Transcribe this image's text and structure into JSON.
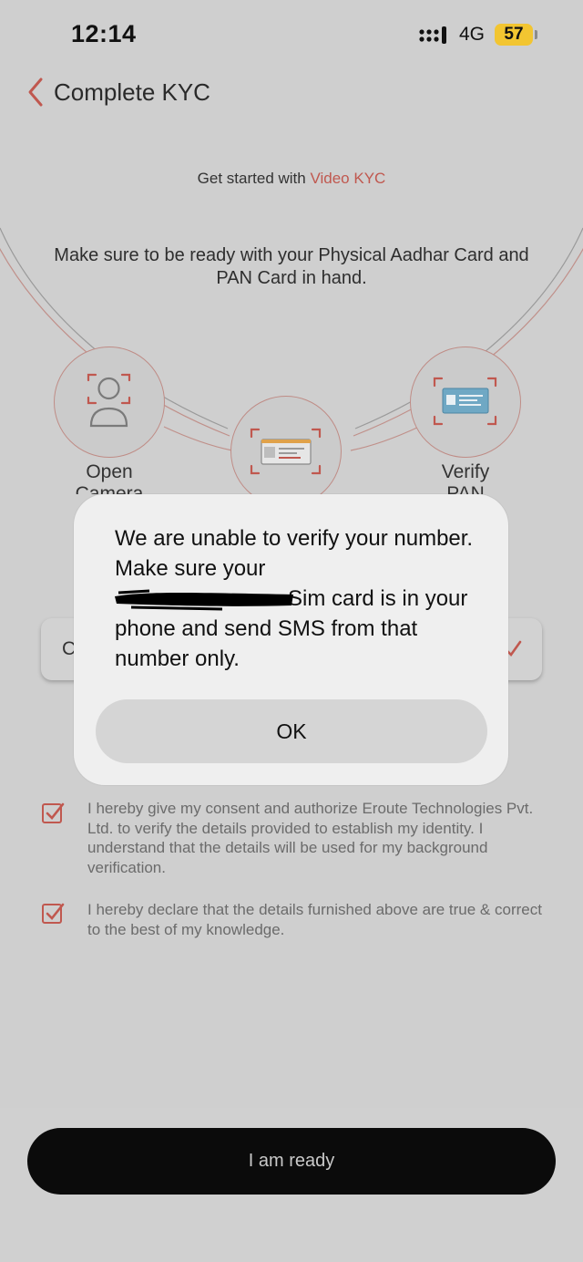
{
  "status_bar": {
    "time": "12:14",
    "network": "4G",
    "battery": "57"
  },
  "header": {
    "title": "Complete KYC"
  },
  "intro": {
    "prefix": "Get started with ",
    "highlight": "Video KYC",
    "instructions": "Make sure to be ready with your Physical Aadhar Card and PAN Card in hand."
  },
  "steps": [
    {
      "label": "Open\nCamera",
      "icon": "face-scan-icon"
    },
    {
      "label": "",
      "icon": "aadhar-card-scan-icon"
    },
    {
      "label": "Verify\nPAN",
      "icon": "pan-card-scan-icon"
    }
  ],
  "input": {
    "visible_text": "C"
  },
  "consents": [
    {
      "text": "I hereby give my consent and authorize Eroute Technologies Pvt. Ltd. to verify the details provided to establish my identity. I understand that the details will be used for my background verification.",
      "checked": true
    },
    {
      "text": "I hereby declare that the details furnished above are true & correct to the best of my knowledge.",
      "checked": true
    }
  ],
  "primary_button": {
    "label": "I am ready"
  },
  "dialog": {
    "message_line1": "We are unable to verify your number.  Make sure your",
    "message_line2": "Sim card is in your phone and send SMS from that number only.",
    "ok_label": "OK"
  },
  "colors": {
    "accent": "#c0584f",
    "background": "#cfcfcf",
    "dialog": "#efefef",
    "button": "#0b0b0b"
  }
}
